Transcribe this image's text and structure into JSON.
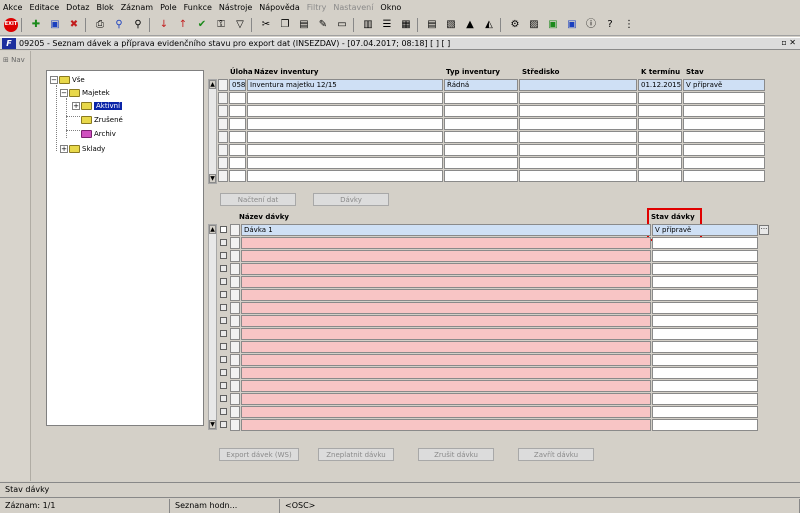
{
  "menu": [
    "Akce",
    "Editace",
    "Dotaz",
    "Blok",
    "Záznam",
    "Pole",
    "Funkce",
    "Nástroje",
    "Nápověda",
    "Filtry",
    "Nastavení",
    "Okno"
  ],
  "menu_disabled": [
    "Filtry",
    "Nastavení"
  ],
  "toolbar": {
    "exit_label": "EXIT",
    "icons": [
      "exit-icon",
      "new-record-icon",
      "save-icon",
      "delete-record-icon",
      "print-icon",
      "query-icon",
      "query-execute-icon",
      "cancel-query-icon",
      "sort-asc-icon",
      "sort-desc-icon",
      "accept-icon",
      "remove-filter-icon",
      "filter-icon",
      "cut-icon",
      "copy-icon",
      "paste-icon",
      "edit-icon",
      "clear-icon",
      "columns-icon",
      "list-icon",
      "form-icon",
      "export-icon",
      "attachment-icon",
      "alert-icon",
      "report-icon",
      "settings-icon",
      "excel-icon",
      "word-icon",
      "info-icon",
      "help-icon",
      "notes-icon"
    ]
  },
  "window": {
    "title": "09205 - Seznam dávek a příprava evidenčního stavu pro export dat (INSEZDAV) - [07.04.2017; 08:18] [ ] [ ]",
    "icon_label": "F",
    "controls": "▫ ✕"
  },
  "nav": {
    "label": "Nav"
  },
  "tree": {
    "root": "Vše",
    "nodes": [
      "Majetek",
      "Aktivní",
      "Zrušené",
      "Archiv",
      "Sklady"
    ],
    "selected": "Aktivní"
  },
  "inventory_grid": {
    "headers": [
      "Úloha",
      "Název inventury",
      "Typ inventury",
      "Středisko",
      "K termínu",
      "Stav"
    ],
    "rows": [
      {
        "uloha": "058",
        "nazev": "Inventura majetku 12/15",
        "typ": "Řádná",
        "stredisko": "",
        "termin": "01.12.2015",
        "stav": "V přípravě"
      }
    ],
    "empty_rows": 7
  },
  "buttons_mid": {
    "nacteni": "Načtení dat",
    "davky": "Dávky"
  },
  "batch_grid": {
    "headers": {
      "nazev": "Název dávky",
      "stav": "Stav dávky"
    },
    "rows": [
      {
        "nazev": "Dávka 1",
        "stav": "V přípravě"
      }
    ],
    "empty_rows": 15,
    "lov_label": "···"
  },
  "buttons_bottom": {
    "export": "Export dávek (WS)",
    "zneplatnit": "Zneplatnit dávku",
    "zrusit": "Zrušit dávku",
    "zavrit": "Zavřít dávku"
  },
  "status": {
    "hint": "Stav dávky",
    "record": "Záznam: 1/1",
    "list": "Seznam hodn...",
    "mode": "<OSC>"
  },
  "colors": {
    "selection": "#0a24a8",
    "required_field": "#f8c5c5",
    "highlight": "#e00000"
  }
}
